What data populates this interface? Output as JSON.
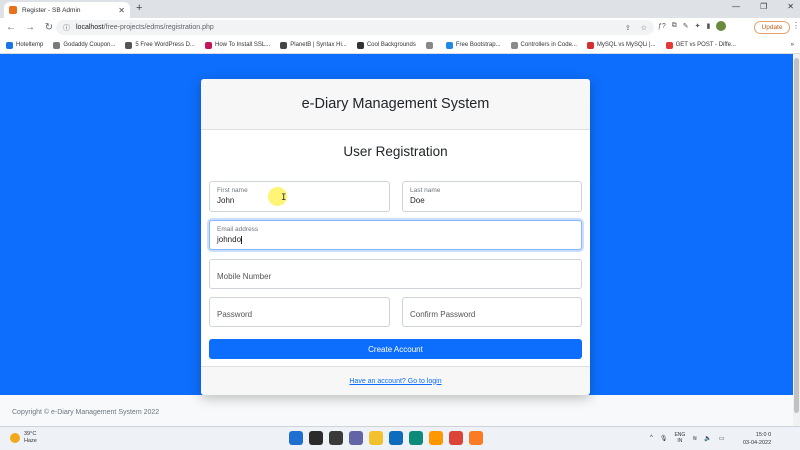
{
  "browser": {
    "tab_title": "Register - SB Admin",
    "tab_close": "✕",
    "new_tab": "+",
    "win_min": "—",
    "win_max": "❐",
    "win_close": "✕",
    "back": "←",
    "forward": "→",
    "reload": "↻",
    "lock": "ⓘ",
    "url_host": "localhost",
    "url_path": "/free-projects/edms/registration.php",
    "share": "⇪",
    "star": "☆",
    "ext_icons": [
      "ƒ?",
      "⧉",
      "✎",
      "✦",
      "▮"
    ],
    "update_label": "Update",
    "menu_dots": "⋮",
    "bookmarks": [
      {
        "label": "Hoteltemp",
        "color": "#1a73e8"
      },
      {
        "label": "Godaddy Coupon...",
        "color": "#7a7a7a"
      },
      {
        "label": "5 Free WordPress D...",
        "color": "#555555"
      },
      {
        "label": "How To Install SSL...",
        "color": "#c2185b"
      },
      {
        "label": "PlanetB | Syntax Hi...",
        "color": "#444444"
      },
      {
        "label": "Cool Backgrounds",
        "color": "#333333"
      },
      {
        "label": "",
        "color": "#888888"
      },
      {
        "label": "Free Bootstrap...",
        "color": "#1e88e5"
      },
      {
        "label": "Controllers in Code...",
        "color": "#8a8a8a"
      },
      {
        "label": "MySQL vs MySQLi |...",
        "color": "#d32f2f"
      },
      {
        "label": "GET vs POST - Diffe...",
        "color": "#e53935"
      }
    ],
    "all_bookmarks": "»"
  },
  "page": {
    "card_title": "e-Diary Management System",
    "heading": "User Registration",
    "fields": {
      "first_name": {
        "label": "First name",
        "value": "John"
      },
      "last_name": {
        "label": "Last name",
        "value": "Doe"
      },
      "email": {
        "label": "Email address",
        "value": "johndo"
      },
      "mobile": {
        "placeholder": "Mobile Number"
      },
      "password": {
        "placeholder": "Password"
      },
      "confirm": {
        "placeholder": "Confirm Password"
      }
    },
    "create_button": "Create Account",
    "login_link": "Have an account? Go to login",
    "footer_text": "Copyright © e-Diary Management System 2022",
    "mouse_cursor": "I"
  },
  "taskbar": {
    "temperature": "39°C",
    "condition": "Haze",
    "apps": [
      {
        "name": "start",
        "color": "#1f6fd1"
      },
      {
        "name": "search",
        "color": "#2b2b2b"
      },
      {
        "name": "task-view",
        "color": "#3a3a3a"
      },
      {
        "name": "chat",
        "color": "#6264a7"
      },
      {
        "name": "file-explorer",
        "color": "#f2c12e"
      },
      {
        "name": "mail",
        "color": "#0f6cbd"
      },
      {
        "name": "edge",
        "color": "#0c8a7a"
      },
      {
        "name": "sublime",
        "color": "#ff9800"
      },
      {
        "name": "chrome",
        "color": "#db4437"
      },
      {
        "name": "xampp",
        "color": "#fb7a24"
      }
    ],
    "tray_chevron": "^",
    "tray_mic": "🎙",
    "lang_top": "ENG",
    "lang_bottom": "IN",
    "tray_wifi": "≋",
    "tray_volume": "🔈",
    "tray_battery": "▭",
    "time": "15:0 0",
    "date": "03-04-2022"
  },
  "colors": {
    "primary": "#0d6efd",
    "page_bg": "#0d6efd",
    "footer_bg": "#f8f9fa"
  }
}
